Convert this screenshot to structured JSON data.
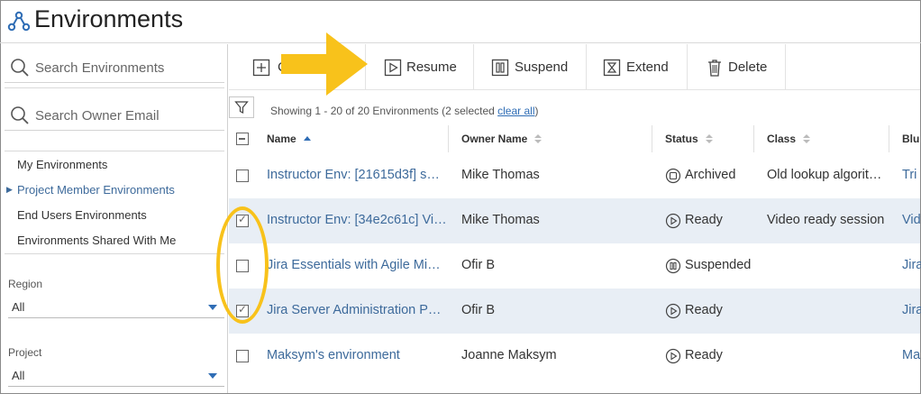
{
  "header": {
    "title": "Environments"
  },
  "sidebar": {
    "search_env_placeholder": "Search Environments",
    "search_owner_placeholder": "Search Owner Email",
    "nav_items": [
      {
        "label": "My Environments",
        "active": false
      },
      {
        "label": "Project Member Environments",
        "active": true
      },
      {
        "label": "End Users Environments",
        "active": false
      },
      {
        "label": "Environments Shared With Me",
        "active": false
      }
    ],
    "region": {
      "label": "Region",
      "value": "All"
    },
    "project": {
      "label": "Project",
      "value": "All"
    }
  },
  "toolbar": {
    "create_label": "C",
    "resume_label": "Resume",
    "suspend_label": "Suspend",
    "extend_label": "Extend",
    "delete_label": "Delete"
  },
  "grid": {
    "showing_prefix": "Showing 1 - 20 of 20 Environments (2 selected ",
    "clear_all": "clear all",
    "showing_suffix": ")",
    "columns": {
      "name": "Name",
      "owner": "Owner Name",
      "status": "Status",
      "class": "Class",
      "blueprint": "Blu"
    },
    "rows": [
      {
        "name": "Instructor Env: [21615d3f] s…",
        "owner": "Mike Thomas",
        "status": "Archived",
        "status_icon": "archived-icon",
        "class": "Old lookup algorit…",
        "blueprint": "Tri",
        "selected": false
      },
      {
        "name": "Instructor Env: [34e2c61c] Vi…",
        "owner": "Mike Thomas",
        "status": "Ready",
        "status_icon": "play-icon",
        "class": "Video ready session",
        "blueprint": "Vid",
        "selected": true
      },
      {
        "name": "Jira Essentials with Agile Mi…",
        "owner": "Ofir B",
        "status": "Suspended",
        "status_icon": "pause-icon",
        "class": "",
        "blueprint": "Jira",
        "selected": false
      },
      {
        "name": "Jira Server Administration P…",
        "owner": "Ofir B",
        "status": "Ready",
        "status_icon": "play-icon",
        "class": "",
        "blueprint": "Jira",
        "selected": true
      },
      {
        "name": "Maksym's environment",
        "owner": "Joanne Maksym",
        "status": "Ready",
        "status_icon": "play-icon",
        "class": "",
        "blueprint": "Ma",
        "selected": false
      }
    ]
  },
  "colors": {
    "accent": "#2f6db5",
    "link": "#3d6a9b",
    "selected_row": "#e8eef5",
    "annotation": "#f8c21b"
  }
}
